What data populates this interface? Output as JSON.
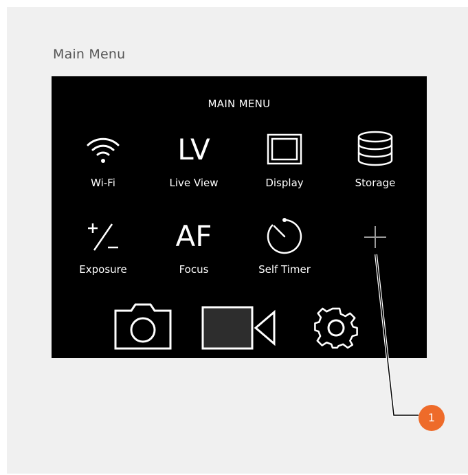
{
  "figure": {
    "caption": "Main Menu",
    "callout_number": "1"
  },
  "screen": {
    "title": "MAIN MENU",
    "menu_items": [
      {
        "label": "Wi-Fi",
        "icon": "wifi-icon"
      },
      {
        "label": "Live View",
        "icon_text": "LV"
      },
      {
        "label": "Display",
        "icon": "display-icon"
      },
      {
        "label": "Storage",
        "icon": "storage-icon"
      },
      {
        "label": "Exposure",
        "icon": "exposure-icon"
      },
      {
        "label": "Focus",
        "icon_text": "AF"
      },
      {
        "label": "Self Timer",
        "icon": "self-timer-icon"
      },
      {
        "label": "",
        "icon": "add-icon"
      }
    ],
    "bottom_bar": [
      {
        "icon": "photo-camera-icon"
      },
      {
        "icon": "video-camera-icon"
      },
      {
        "icon": "settings-gear-icon"
      }
    ]
  },
  "colors": {
    "screen_background": "#000000",
    "panel_background": "#f0f0f0",
    "callout_accent": "#ee6b2a",
    "placeholder_icon": "#888888"
  }
}
